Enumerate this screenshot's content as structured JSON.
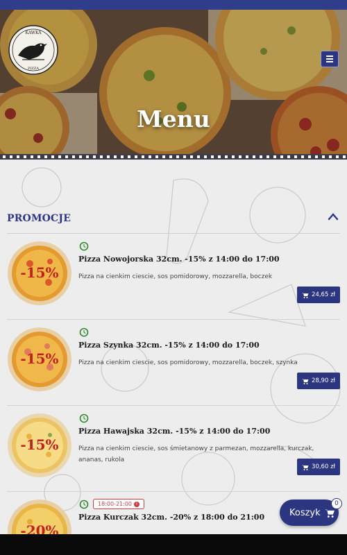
{
  "hero": {
    "title": "Menu"
  },
  "logo": {
    "top_text": "KAWKA",
    "bottom_text": "PIZZA"
  },
  "section": {
    "title": "PROMOCJE"
  },
  "items": [
    {
      "name": "Pizza Nowojorska 32cm. -15% z 14:00 do 17:00",
      "desc": "Pizza na cienkim ciescie, sos pomidorowy, mozzarella, boczek",
      "price": "24,65 zł",
      "discount": "-15%",
      "time_badge": ""
    },
    {
      "name": "Pizza Szynka 32cm. -15% z 14:00 do 17:00",
      "desc": "Pizza na cienkim ciescie, sos pomidorowy, mozzarella, boczek, szynka",
      "price": "28,90 zł",
      "discount": "-15%",
      "time_badge": ""
    },
    {
      "name": "Pizza Hawajska 32cm. -15% z 14:00 do 17:00",
      "desc": "Pizza na cienkim ciescie, sos śmietanowy z parmezan, mozzarella, kurczak, ananas, rukola",
      "price": "30,60 zł",
      "discount": "-15%",
      "time_badge": ""
    },
    {
      "name": "Pizza Kurczak 32cm. -20% z 18:00 do 21:00",
      "desc": "",
      "price": "",
      "discount": "-20%",
      "time_badge": "18:00-21:00"
    }
  ],
  "cart": {
    "label": "Koszyk",
    "count": "0"
  },
  "colors": {
    "accent": "#2c3580",
    "topbar": "#2f3d8a",
    "clock": "#2e8b2e",
    "badge": "#c94040"
  }
}
